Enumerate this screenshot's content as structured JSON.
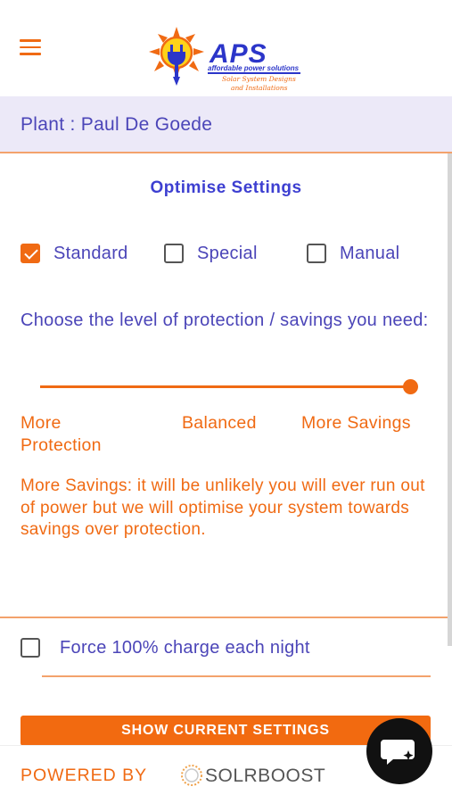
{
  "header": {
    "logo": {
      "brand": "APS",
      "subtitle": "affordable power solutions",
      "tagline_1": "Solar System Designs",
      "tagline_2": "and Installations"
    }
  },
  "plant": {
    "label": "Plant : Paul De Goede"
  },
  "optimise": {
    "title": "Optimise Settings",
    "modes": [
      {
        "label": "Standard",
        "checked": true
      },
      {
        "label": "Special",
        "checked": false
      },
      {
        "label": "Manual",
        "checked": false
      }
    ],
    "question": "Choose the level of protection / savings you need:",
    "slider": {
      "value": 1.0
    },
    "scale": {
      "left": "More Protection",
      "middle": "Balanced",
      "right": "More Savings"
    },
    "description": "More Savings: it will be unlikely you will ever run out of power but we will optimise your system towards savings over protection."
  },
  "force_charge": {
    "label": "Force 100% charge each night",
    "checked": false
  },
  "show_button": {
    "label": "SHOW CURRENT SETTINGS"
  },
  "footer": {
    "powered_by": "POWERED BY",
    "brand": "SOLRBOOST"
  },
  "colors": {
    "accent": "#f06a13",
    "primary_text": "#4b45b8",
    "title": "#3d3fd1",
    "plant_bg": "#ece9f8"
  },
  "icons": [
    "menu-icon",
    "aps-sun-plug-icon",
    "checkbox-icon",
    "solrboost-logo-icon",
    "chat-icon"
  ]
}
